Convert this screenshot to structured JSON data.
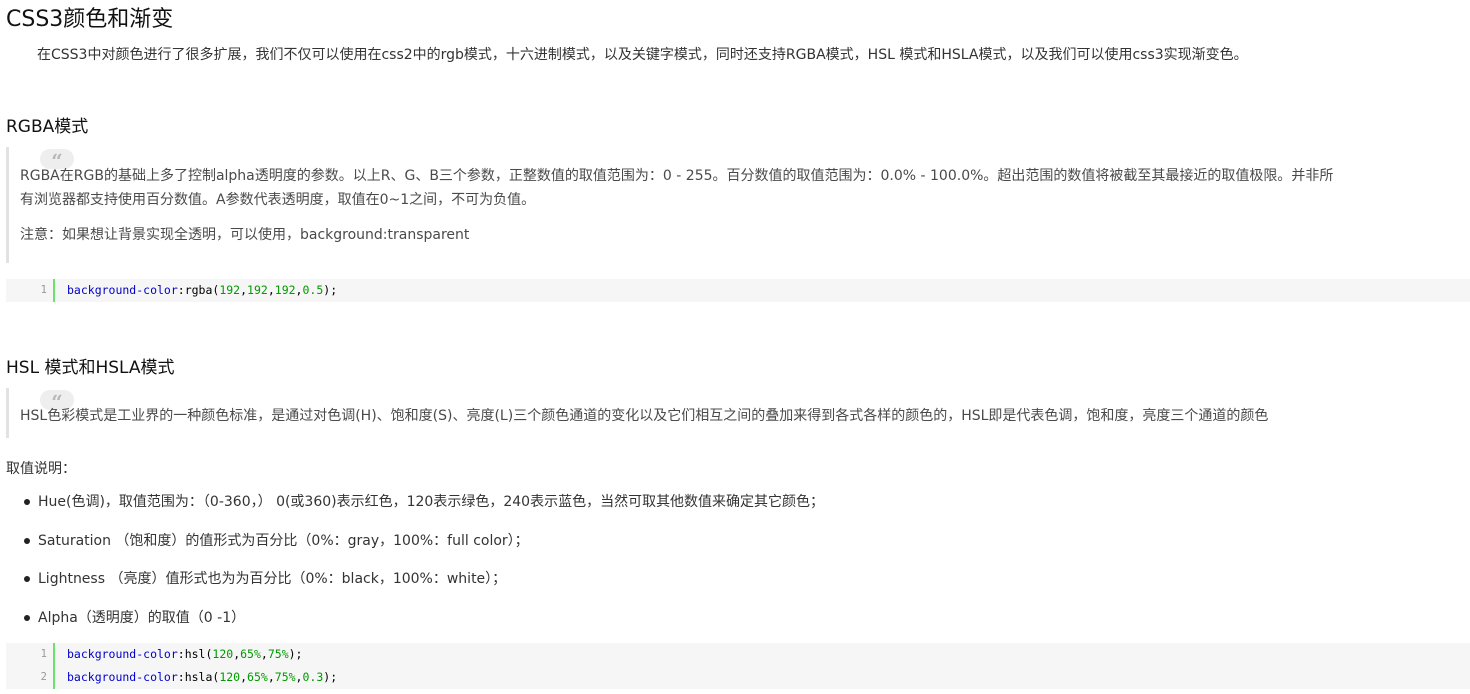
{
  "title": "CSS3颜色和渐变",
  "intro": "在CSS3中对颜色进行了很多扩展，我们不仅可以使用在css2中的rgb模式，十六进制模式，以及关键字模式，同时还支持RGBA模式，HSL 模式和HSLA模式，以及我们可以使用css3实现渐变色。",
  "rgba_section": {
    "heading": "RGBA模式",
    "quote_icon": "quote-icon",
    "quote_line1": "RGBA在RGB的基础上多了控制alpha透明度的参数。以上R、G、B三个参数，正整数值的取值范围为：0 - 255。百分数值的取值范围为：0.0% - 100.0%。超出范围的数值将被截至其最接近的取值极限。并非所",
    "quote_line2": "有浏览器都支持使用百分数值。A参数代表透明度，取值在0~1之间，不可为负值。",
    "quote_note": "注意：如果想让背景实现全透明，可以使用，background:transparent",
    "code": [
      {
        "ln": "1",
        "prop": "background-color",
        "colon": ":",
        "fn": "rgba(",
        "args": [
          {
            "t": "192",
            "n": true
          },
          {
            "t": ",",
            "n": false
          },
          {
            "t": "192",
            "n": true
          },
          {
            "t": ",",
            "n": false
          },
          {
            "t": "192",
            "n": true
          },
          {
            "t": ",",
            "n": false
          },
          {
            "t": "0.5",
            "n": true
          }
        ],
        "end": ");"
      }
    ]
  },
  "hsl_section": {
    "heading": "HSL 模式和HSLA模式",
    "quote_icon": "quote-icon",
    "quote_text": "HSL色彩模式是工业界的一种颜色标准，是通过对色调(H)、饱和度(S)、亮度(L)三个颜色通道的变化以及它们相互之间的叠加来得到各式各样的颜色的，HSL即是代表色调，饱和度，亮度三个通道的颜色",
    "value_heading": "取值说明：",
    "bullets": [
      "Hue(色调)，取值范围为：（0-360，） 0(或360)表示红色，120表示绿色，240表示蓝色，当然可取其他数值来确定其它颜色；",
      "Saturation （饱和度）的值形式为百分比（0%：gray，100%：full color）；",
      "Lightness （亮度）值形式也为为百分比（0%：black，100%：white）；",
      "Alpha（透明度）的取值（0 -1）"
    ],
    "code": [
      {
        "ln": "1",
        "prop": "background-color",
        "colon": ":",
        "fn": "hsl(",
        "args": [
          {
            "t": "120",
            "n": true
          },
          {
            "t": ",",
            "n": false
          },
          {
            "t": "65%",
            "n": true
          },
          {
            "t": ",",
            "n": false
          },
          {
            "t": "75%",
            "n": true
          }
        ],
        "end": ");"
      },
      {
        "ln": "2",
        "prop": "background-color",
        "colon": ":",
        "fn": "hsla(",
        "args": [
          {
            "t": "120",
            "n": true
          },
          {
            "t": ",",
            "n": false
          },
          {
            "t": "65%",
            "n": true
          },
          {
            "t": ",",
            "n": false
          },
          {
            "t": "75%",
            "n": true
          },
          {
            "t": ",",
            "n": false
          },
          {
            "t": "0.3",
            "n": true
          }
        ],
        "end": ");"
      }
    ]
  },
  "colors": {
    "code_property": "#0000cc",
    "code_number": "#009900",
    "gutter_bar": "#6ce26c",
    "code_bg": "#f6f6f6"
  }
}
